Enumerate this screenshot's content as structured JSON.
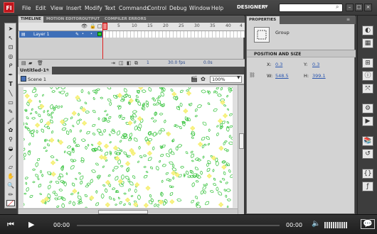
{
  "app": {
    "logo_text": "Fl"
  },
  "menu": [
    "File",
    "Edit",
    "View",
    "Insert",
    "Modify",
    "Text",
    "Commands",
    "Control",
    "Debug",
    "Window",
    "Help"
  ],
  "workspace": "DESIGNER",
  "timeline": {
    "tabs": [
      "TIMELINE",
      "MOTION EDITOR",
      "OUTPUT",
      "COMPILER ERRORS"
    ],
    "frame_numbers": [
      "1",
      "5",
      "10",
      "15",
      "20",
      "25",
      "30",
      "35",
      "40",
      "4"
    ],
    "layer_name": "Layer 1",
    "status": {
      "frame": "1",
      "fps": "30.0 fps",
      "time": "0.0s"
    }
  },
  "document": {
    "tab": "Untitled-1*",
    "scene": "Scene 1",
    "zoom": "100%"
  },
  "properties": {
    "tab": "PROPERTIES",
    "object_type": "Group",
    "section": "POSITION AND SIZE",
    "x_label": "X:",
    "x": "0.3",
    "y_label": "Y:",
    "y": "0.3",
    "w_label": "W:",
    "w": "548.5",
    "h_label": "H:",
    "h": "399.1"
  },
  "player": {
    "time_start": "00:00",
    "time_end": "00:00"
  },
  "colors": {
    "leaf_green": "#34c23a",
    "flower_yellow": "#f6f07a",
    "accent_red": "#c0141b"
  },
  "icons": {
    "tools": [
      "selection",
      "subselection",
      "free-transform",
      "3d-rotation",
      "lasso",
      "pen",
      "text",
      "line",
      "rectangle",
      "pencil",
      "brush",
      "deco",
      "bone",
      "paint-bucket",
      "eyedropper",
      "eraser",
      "hand",
      "zoom",
      "stroke-color",
      "fill-color"
    ],
    "right_panel": [
      "color",
      "swatches",
      "align",
      "info",
      "transform",
      "components",
      "motion-presets",
      "library",
      "history",
      "code-snippets",
      "actions"
    ]
  }
}
